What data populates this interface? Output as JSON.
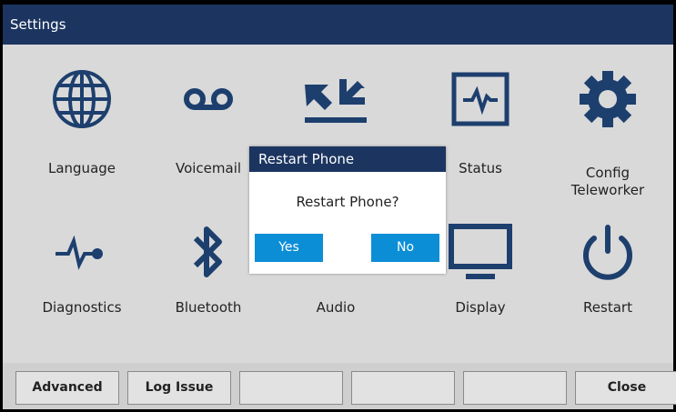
{
  "window": {
    "title": "Settings"
  },
  "colors": {
    "header": "#1c3560",
    "icon": "#1d3f6e",
    "button": "#0b8ed6",
    "background": "#d9d9d9"
  },
  "grid": {
    "row1": [
      {
        "label": "Language",
        "icon": "globe-icon"
      },
      {
        "label": "Voicemail",
        "icon": "voicemail-icon"
      },
      {
        "label": "",
        "icon": "arrows-icon"
      },
      {
        "label": "Status",
        "icon": "status-monitor-icon"
      },
      {
        "label": "Config Teleworker",
        "icon": "gear-icon"
      }
    ],
    "row2": [
      {
        "label": "Diagnostics",
        "icon": "pulse-icon"
      },
      {
        "label": "Bluetooth",
        "icon": "bluetooth-icon"
      },
      {
        "label": "Audio",
        "icon": "speaker-icon"
      },
      {
        "label": "Display",
        "icon": "monitor-icon"
      },
      {
        "label": "Restart",
        "icon": "power-icon"
      }
    ]
  },
  "dialog": {
    "title": "Restart Phone",
    "message": "Restart Phone?",
    "yes_label": "Yes",
    "no_label": "No"
  },
  "softkeys": [
    "Advanced",
    "Log Issue",
    "",
    "",
    "",
    "Close"
  ]
}
